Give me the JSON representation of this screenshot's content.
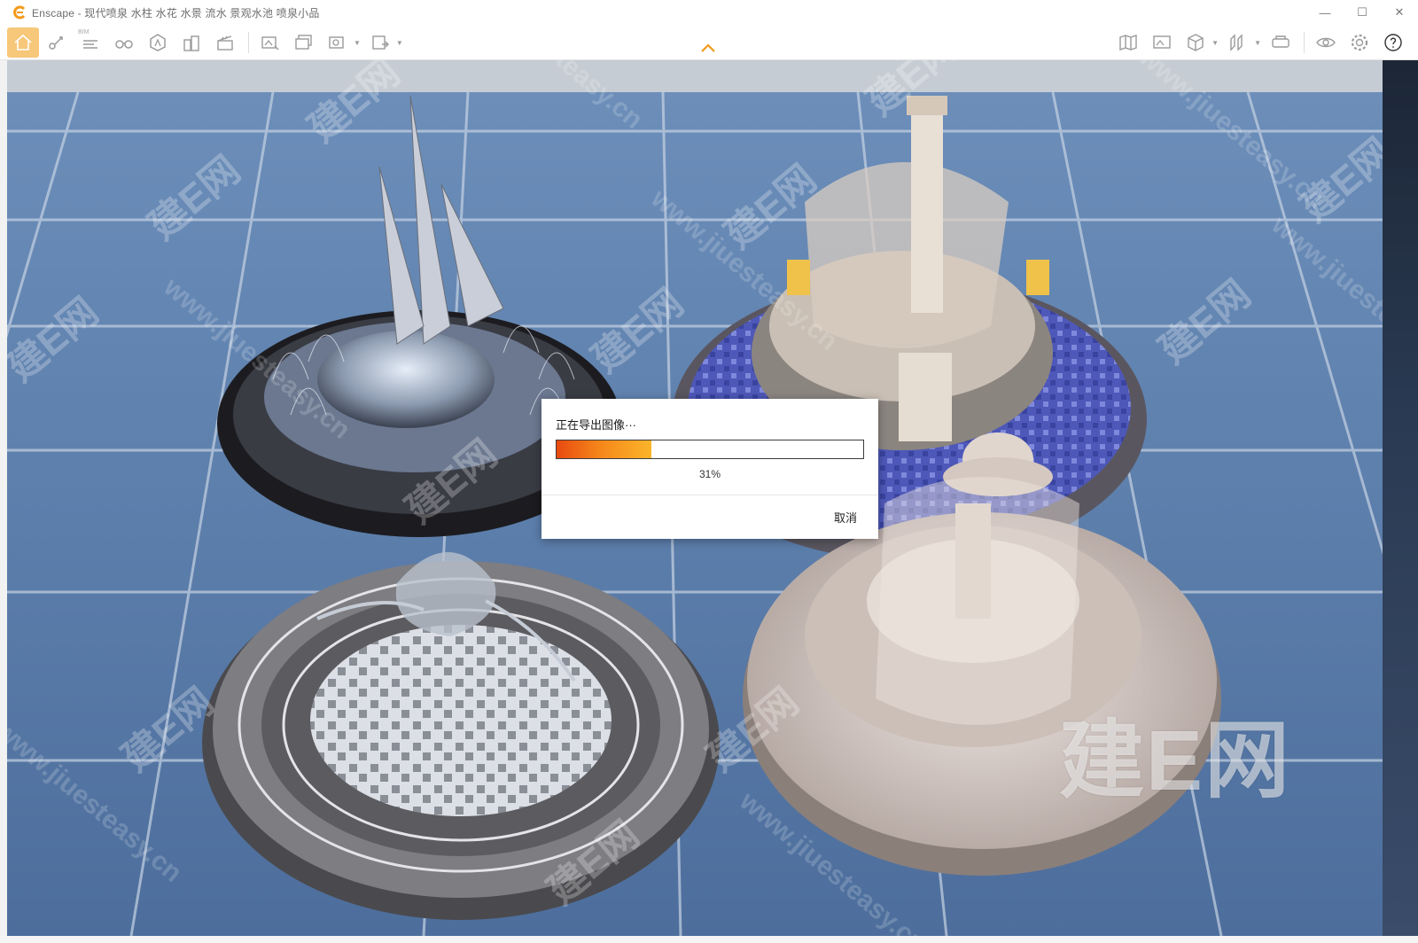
{
  "window": {
    "app_name": "Enscape",
    "title": "Enscape - 现代喷泉 水柱 水花 水景 流水 景观水池 喷泉小品",
    "controls": {
      "minimize": "—",
      "maximize": "☐",
      "close": "✕"
    }
  },
  "toolbar": {
    "bim_label": "BIM",
    "left_buttons": [
      {
        "name": "home-icon",
        "active": true
      },
      {
        "name": "video-path-icon"
      },
      {
        "name": "bim-info-icon"
      },
      {
        "name": "binoculars-icon"
      },
      {
        "name": "assets-icon"
      },
      {
        "name": "buildings-icon"
      },
      {
        "name": "clapper-icon"
      },
      {
        "name": "export-image-icon"
      },
      {
        "name": "batch-render-icon"
      },
      {
        "name": "export-panorama-icon"
      },
      {
        "name": "export-exe-icon"
      }
    ],
    "right_buttons": [
      {
        "name": "map-icon"
      },
      {
        "name": "screen-icon"
      },
      {
        "name": "cube-icon"
      },
      {
        "name": "section-icon"
      },
      {
        "name": "vr-icon"
      },
      {
        "name": "visibility-icon"
      },
      {
        "name": "settings-icon"
      },
      {
        "name": "help-icon"
      }
    ]
  },
  "dialog": {
    "title": "正在导出图像···",
    "progress_fraction": 0.31,
    "progress_text": "31%",
    "cancel_label": "取消"
  },
  "watermark": {
    "brand": "建E网",
    "url": "www.jiuesteasy.cn",
    "big": "建E网"
  },
  "colors": {
    "accent": "#f7a21b",
    "progress_start": "#e84a10",
    "progress_end": "#fbb52a"
  }
}
